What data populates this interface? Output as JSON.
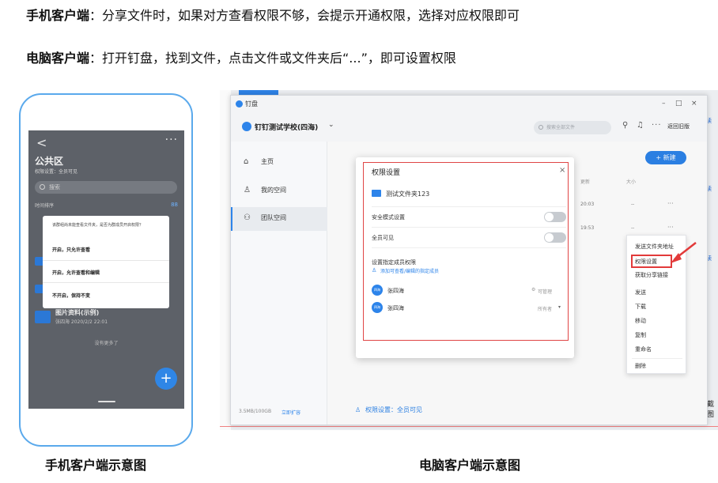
{
  "instructions": {
    "mobile_label": "手机客户端",
    "mobile_text": "：分享文件时，如果对方查看权限不够，会提示开通权限，选择对应权限即可",
    "desktop_label": "电脑客户端",
    "desktop_text": "：打开钉盘，找到文件，点击文件或文件夹后“...”，即可设置权限"
  },
  "captions": {
    "mobile": "手机客户端示意图",
    "desktop": "电脑客户端示意图"
  },
  "phone": {
    "back": "<",
    "more": "···",
    "title": "公共区",
    "subtitle": "权限设置：全员可见",
    "search_placeholder": "搜索",
    "sort": "时间排序",
    "grid_icon": "88",
    "dialog": {
      "message": "该群组尚未能查看文件夹，是否为群成员开启权限？",
      "options": [
        "开启，只允许查看",
        "开启，允许查看和编辑",
        "不开启，保持不变"
      ]
    },
    "item_name": "图片资料(示例)",
    "item_meta": "张四海 2020/2/2 22:01",
    "no_more": "没有更多了",
    "fab": "+"
  },
  "desktop": {
    "window_title": "钉盘",
    "window_controls": [
      "–",
      "□",
      "×"
    ],
    "org_name": "钉钉测试学校(四海)",
    "org_dropdown": "⌄",
    "search_placeholder": "搜索全部文件",
    "old_version": "返回旧版",
    "sidebar": [
      {
        "icon": "⌂",
        "label": "主页"
      },
      {
        "icon": "♙",
        "label": "我的空间"
      },
      {
        "icon": "⚇",
        "label": "团队空间"
      }
    ],
    "storage": "3.5MB/100GB",
    "expand": "立即扩容",
    "new_button": "+ 新建",
    "columns": {
      "updated": "更新",
      "size": "大小"
    },
    "rows": [
      {
        "time": "20:03",
        "size": "--",
        "more": "···"
      },
      {
        "time": "19:53",
        "size": "--",
        "more": "···"
      }
    ],
    "permission_bar": "权限设置：全员可见",
    "modal": {
      "title": "权限设置",
      "close": "×",
      "folder": "测试文件夹123",
      "safe_mode": "安全模式设置",
      "all_visible": "全员可见",
      "assign_label": "设置指定成员权限",
      "add_member": "添加可查看/编辑的指定成员",
      "members": [
        {
          "avatar": "四海",
          "name": "张四海",
          "role": "可管理"
        },
        {
          "avatar": "四海",
          "name": "张四海",
          "role": "所有者"
        }
      ]
    },
    "context_menu": [
      "发送文件夹地址",
      "权限设置",
      "获取分享链接",
      "发送",
      "下载",
      "移动",
      "复制",
      "重命名",
      "删除"
    ],
    "edge_labels": [
      "读",
      "读",
      "读",
      "截图"
    ]
  }
}
